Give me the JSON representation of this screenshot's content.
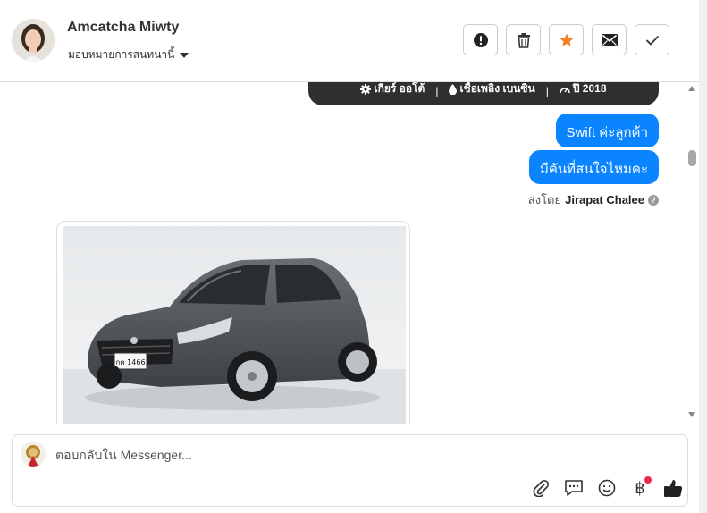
{
  "header": {
    "contact_name": "Amcatcha Miwty",
    "assign_label": "มอบหมายการสนทนานี้",
    "actions": [
      {
        "name": "spam-report-button",
        "icon": "alert-circle-icon"
      },
      {
        "name": "delete-button",
        "icon": "trash-icon"
      },
      {
        "name": "star-button",
        "icon": "star-icon"
      },
      {
        "name": "mark-unread-button",
        "icon": "envelope-icon"
      },
      {
        "name": "mark-done-button",
        "icon": "checkmark-icon"
      }
    ]
  },
  "conversation": {
    "spec_card": {
      "gear": "เกียร์ ออโต้",
      "fuel": "เชื้อเพลิง เบนซิน",
      "year": "ปี 2018"
    },
    "messages": [
      {
        "text": "Swift ค่ะลูกค้า"
      },
      {
        "text": "มีคันที่สนใจไหมคะ"
      }
    ],
    "sent_by_prefix": "ส่งโดย",
    "sent_by_name": "Jirapat Chalee",
    "car_plate": "กค 1466"
  },
  "composer": {
    "placeholder": "ตอบกลับใน Messenger..."
  },
  "colors": {
    "bubble": "#0a84ff",
    "star": "#f48024",
    "spec_card": "#2d2f31"
  }
}
